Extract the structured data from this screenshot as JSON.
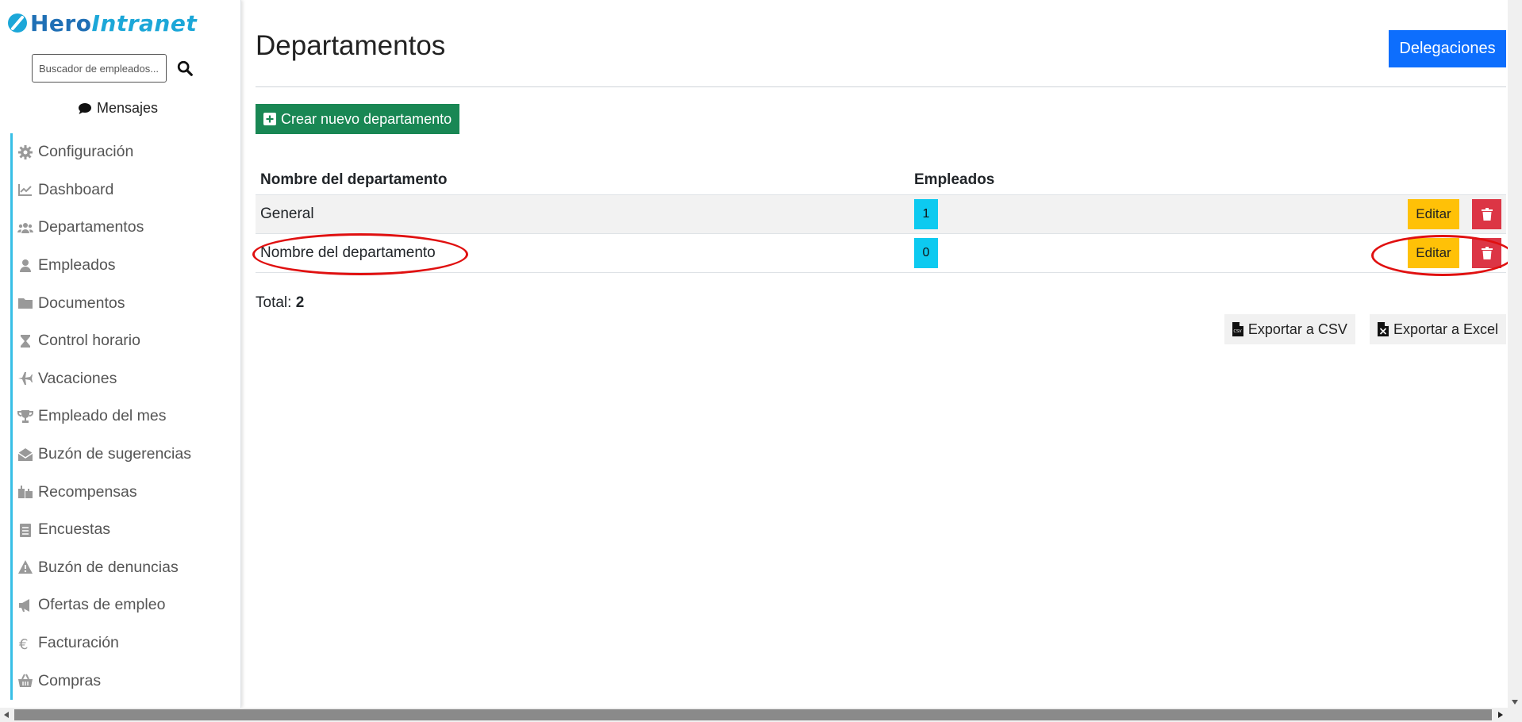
{
  "brand": {
    "hero": "Hero",
    "intranet": "Intranet",
    "colors": {
      "hero": "#1f6fb5",
      "intranet": "#1ca7d8"
    }
  },
  "search": {
    "placeholder": "Buscador de empleados..."
  },
  "messages_label": "Mensajes",
  "sidebar": {
    "items": [
      {
        "label": "Configuración",
        "icon": "gear-icon"
      },
      {
        "label": "Dashboard",
        "icon": "chart-line-icon"
      },
      {
        "label": "Departamentos",
        "icon": "users-icon"
      },
      {
        "label": "Empleados",
        "icon": "user-icon"
      },
      {
        "label": "Documentos",
        "icon": "folder-icon"
      },
      {
        "label": "Control horario",
        "icon": "hourglass-icon"
      },
      {
        "label": "Vacaciones",
        "icon": "plane-icon"
      },
      {
        "label": "Empleado del mes",
        "icon": "trophy-icon"
      },
      {
        "label": "Buzón de sugerencias",
        "icon": "envelope-open-icon"
      },
      {
        "label": "Recompensas",
        "icon": "gifts-icon"
      },
      {
        "label": "Encuestas",
        "icon": "clipboard-list-icon"
      },
      {
        "label": "Buzón de denuncias",
        "icon": "warning-icon"
      },
      {
        "label": "Ofertas de empleo",
        "icon": "megaphone-icon"
      },
      {
        "label": "Facturación",
        "icon": "euro-icon"
      },
      {
        "label": "Compras",
        "icon": "basket-icon"
      }
    ],
    "accent": "#38bfe6"
  },
  "main": {
    "title": "Departamentos",
    "delegaciones_label": "Delegaciones",
    "create_label": "Crear nuevo departamento",
    "table": {
      "columns": [
        "Nombre del departamento",
        "Empleados"
      ],
      "rows": [
        {
          "name": "General",
          "employees": "1"
        },
        {
          "name": "Nombre del departamento",
          "employees": "0"
        }
      ],
      "edit_label": "Editar"
    },
    "total_label": "Total:",
    "total_value": "2",
    "export_csv_label": "Exportar a CSV",
    "export_excel_label": "Exportar a Excel"
  },
  "colors": {
    "primary": "#0d6efd",
    "success": "#198754",
    "warning": "#ffc107",
    "danger": "#dc3545",
    "info": "#0dcaf0",
    "annotation": "#e01010"
  }
}
